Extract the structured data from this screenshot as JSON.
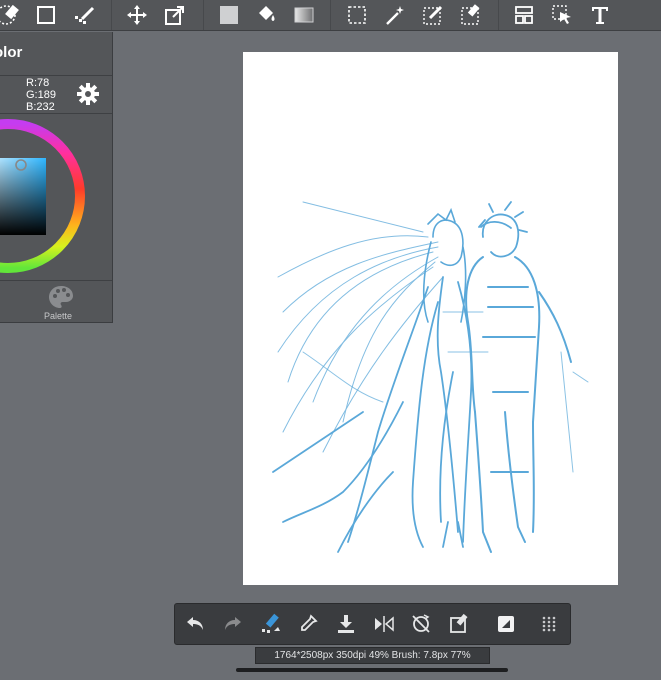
{
  "toolbar": {
    "icons": [
      "eraser-icon",
      "rectangle-icon",
      "dotted-brush-icon",
      "move-icon",
      "transform-icon",
      "fill-color-icon",
      "bucket-icon",
      "gradient-icon",
      "select-rect-icon",
      "magic-wand-icon",
      "select-pen-icon",
      "select-eraser-icon",
      "layout-icon",
      "select-move-icon",
      "text-icon"
    ]
  },
  "color_panel": {
    "title": "olor",
    "r": "R:78",
    "g": "G:189",
    "b": "B:232",
    "palette_label": "Palette",
    "current_color": "#4ebde8"
  },
  "status": {
    "text": "1764*2508px 350dpi 49% Brush: 7.8px 77%"
  },
  "bottom_toolbar": {
    "icons": [
      "undo-icon",
      "redo-icon",
      "brush-pen-icon",
      "eyedropper-icon",
      "import-icon",
      "flip-icon",
      "rotate-reset-icon",
      "quick-edit-icon",
      "layer-icon",
      "grid-menu-icon"
    ]
  }
}
